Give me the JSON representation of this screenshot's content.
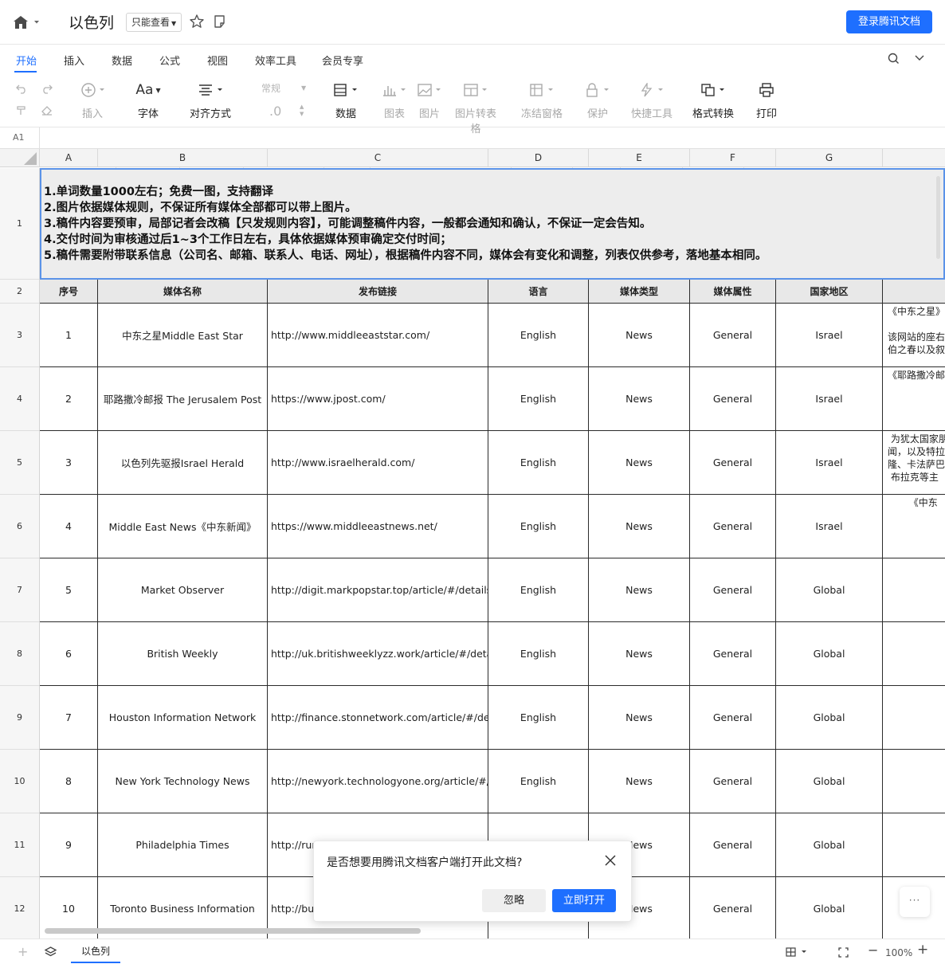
{
  "app": {
    "title": "以色列",
    "readonly_label": "只能查看",
    "login_label": "登录腾讯文档"
  },
  "menu": {
    "tabs": [
      {
        "label": "开始",
        "active": true
      },
      {
        "label": "插入"
      },
      {
        "label": "数据"
      },
      {
        "label": "公式"
      },
      {
        "label": "视图"
      },
      {
        "label": "效率工具"
      },
      {
        "label": "会员专享"
      }
    ]
  },
  "toolbar": {
    "items": [
      {
        "label": "插入",
        "icon": "plus-circle-icon",
        "enabled": false
      },
      {
        "label": "字体",
        "icon": "font-icon",
        "enabled": true
      },
      {
        "label": "对齐方式",
        "icon": "align-icon",
        "enabled": true
      },
      {
        "label": "数据",
        "icon": "data-icon",
        "enabled": true
      },
      {
        "label": "图表",
        "icon": "chart-icon",
        "enabled": false
      },
      {
        "label": "图片",
        "icon": "image-icon",
        "enabled": false
      },
      {
        "label": "图片转表格",
        "icon": "image-to-table-icon",
        "enabled": false
      },
      {
        "label": "冻结窗格",
        "icon": "freeze-icon",
        "enabled": false
      },
      {
        "label": "保护",
        "icon": "lock-icon",
        "enabled": false
      },
      {
        "label": "快捷工具",
        "icon": "quick-tool-icon",
        "enabled": false
      },
      {
        "label": "格式转换",
        "icon": "format-convert-icon",
        "enabled": true
      },
      {
        "label": "打印",
        "icon": "printer-icon",
        "enabled": true
      }
    ],
    "number_format": "常规",
    "decimal_label": ".0"
  },
  "formula_bar": {
    "cell_ref": "A1"
  },
  "grid": {
    "columns": [
      "A",
      "B",
      "C",
      "D",
      "E",
      "F",
      "G"
    ],
    "notes": [
      "1.单词数量1000左右；免费一图，支持翻译",
      "2.图片依据媒体规则，不保证所有媒体全部都可以带上图片。",
      "3.稿件内容要预审，局部记者会改稿【只发规则内容】，可能调整稿件内容，一般都会通知和确认，不保证一定会告知。",
      "4.交付时间为审核通过后1~3个工作日左右，具体依据媒体预审确定交付时间；",
      "5.稿件需要附带联系信息（公司名、邮箱、联系人、电话、网址），根据稿件内容不同，媒体会有变化和调整，列表仅供参考，落地基本相同。"
    ],
    "headers": [
      "序号",
      "媒体名称",
      "发布链接",
      "语言",
      "媒体类型",
      "媒体属性",
      "国家地区"
    ],
    "rows": [
      {
        "no": "1",
        "name": "中东之星Middle East Star",
        "url": "http://www.middleeaststar.com/",
        "lang": "English",
        "type": "News",
        "attr": "General",
        "region": "Israel",
        "desc": "《中东之星》\n\n该网站的座右\n伯之春以及叙"
      },
      {
        "no": "2",
        "name": "耶路撒冷邮报 The Jerusalem Post",
        "url": "https://www.jpost.com/",
        "lang": "English",
        "type": "News",
        "attr": "General",
        "region": "Israel",
        "desc": "《耶路撒冷邮"
      },
      {
        "no": "3",
        "name": "以色列先驱报Israel Herald",
        "url": "http://www.israelherald.com/",
        "lang": "English",
        "type": "News",
        "attr": "General",
        "region": "Israel",
        "desc": " 为犹太国家朋\n闻，以及特拉\n隆、卡法萨巴\n 布拉克等主"
      },
      {
        "no": "4",
        "name": "Middle East News《中东新闻》",
        "url": "https://www.middleeastnews.net/",
        "lang": "English",
        "type": "News",
        "attr": "General",
        "region": "Israel",
        "desc": "       《中东"
      },
      {
        "no": "5",
        "name": "Market Observer",
        "url": "http://digit.markpopstar.top/article/#/details/Em",
        "lang": "English",
        "type": "News",
        "attr": "General",
        "region": "Global",
        "desc": ""
      },
      {
        "no": "6",
        "name": "British Weekly",
        "url": "http://uk.britishweeklyzz.work/article/#/details/E",
        "lang": "English",
        "type": "News",
        "attr": "General",
        "region": "Global",
        "desc": ""
      },
      {
        "no": "7",
        "name": "Houston Information Network",
        "url": "http://finance.stonnetwork.com/article/#/details",
        "lang": "English",
        "type": "News",
        "attr": "General",
        "region": "Global",
        "desc": ""
      },
      {
        "no": "8",
        "name": "New York Technology News",
        "url": "http://newyork.technologyone.org/article/#/deta",
        "lang": "English",
        "type": "News",
        "attr": "General",
        "region": "Global",
        "desc": ""
      },
      {
        "no": "9",
        "name": "Philadelphia Times",
        "url": "http://rur",
        "lang": "",
        "type": "News",
        "attr": "General",
        "region": "Global",
        "desc": ""
      },
      {
        "no": "10",
        "name": "Toronto Business Information",
        "url": "http://bu",
        "lang": "",
        "type": "News",
        "attr": "General",
        "region": "Global",
        "desc": ""
      }
    ]
  },
  "bottom": {
    "sheet_tab": "以色列",
    "zoom": "100%"
  },
  "dialog": {
    "message": "是否想要用腾讯文档客户端打开此文档?",
    "ignore_label": "忽略",
    "open_label": "立即打开"
  },
  "more_label": "···",
  "colors": {
    "accent": "#1e6fff",
    "selection": "#5b93e8"
  }
}
